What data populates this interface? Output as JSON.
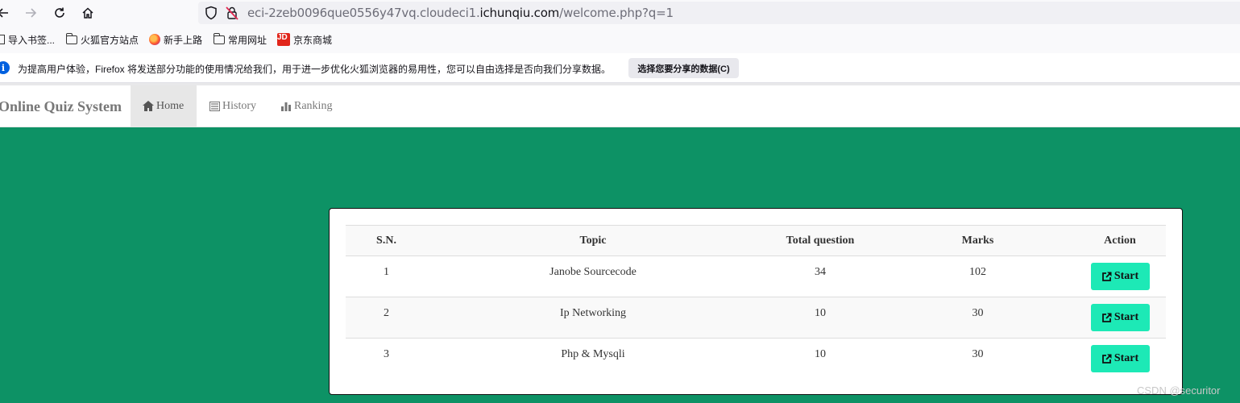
{
  "browser": {
    "url_prefix": "eci-2zeb0096que0556y47vq.cloudeci1.",
    "url_domain": "ichunqiu.com",
    "url_suffix": "/welcome.php?q=1",
    "back_icon": "arrow-left-icon",
    "forward_icon": "arrow-right-icon",
    "reload_icon": "reload-icon",
    "home_icon": "home-icon"
  },
  "bookmarks": [
    {
      "label": "导入书签...",
      "icon": "import-icon"
    },
    {
      "label": "火狐官方站点",
      "icon": "folder-icon"
    },
    {
      "label": "新手上路",
      "icon": "firefox-icon"
    },
    {
      "label": "常用网址",
      "icon": "folder-icon"
    },
    {
      "label": "京东商城",
      "icon": "jd-icon",
      "icon_text": "JD"
    }
  ],
  "notification": {
    "message": "为提高用户体验，Firefox 将发送部分功能的使用情况给我们，用于进一步优化火狐浏览器的易用性，您可以自由选择是否向我们分享数据。",
    "button": "选择您要分享的数据(C)"
  },
  "navbar": {
    "brand": "Online Quiz System",
    "items": [
      {
        "label": "Home",
        "icon": "home-icon",
        "active": true
      },
      {
        "label": "History",
        "icon": "list-icon",
        "active": false
      },
      {
        "label": "Ranking",
        "icon": "bar-chart-icon",
        "active": false
      }
    ]
  },
  "table": {
    "headers": [
      "S.N.",
      "Topic",
      "Total question",
      "Marks",
      "Action"
    ],
    "rows": [
      {
        "sn": "1",
        "topic": "Janobe Sourcecode",
        "total": "34",
        "marks": "102",
        "action": "Start"
      },
      {
        "sn": "2",
        "topic": "Ip Networking",
        "total": "10",
        "marks": "30",
        "action": "Start"
      },
      {
        "sn": "3",
        "topic": "Php & Mysqli",
        "total": "10",
        "marks": "30",
        "action": "Start"
      }
    ]
  },
  "colors": {
    "page_bg": "#0d9265",
    "start_button": "#1de9b6"
  },
  "watermark": "CSDN @securitor"
}
